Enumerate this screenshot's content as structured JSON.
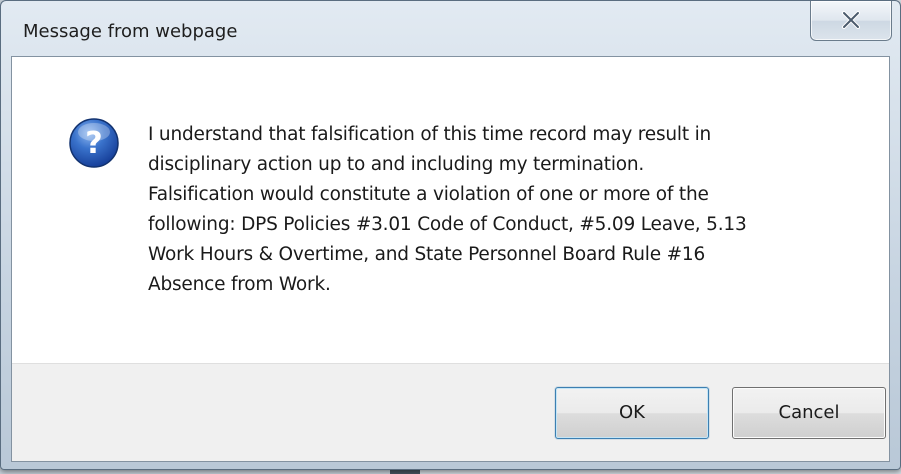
{
  "dialog": {
    "title": "Message from webpage",
    "close_icon": "close-icon",
    "message_icon": "question-icon",
    "message": "I understand that falsification of this time record may result in\ndisciplinary action up to and including my termination.\nFalsification would constitute a  violation of one or more of the\nfollowing:  DPS Policies #3.01 Code of Conduct, #5.09 Leave, 5.13\nWork Hours & Overtime, and State Personnel Board Rule #16\nAbsence from Work.",
    "buttons": {
      "ok_label": "OK",
      "cancel_label": "Cancel"
    }
  },
  "colors": {
    "icon_blue": "#2f66b8",
    "ok_border": "#3c7fb1"
  }
}
